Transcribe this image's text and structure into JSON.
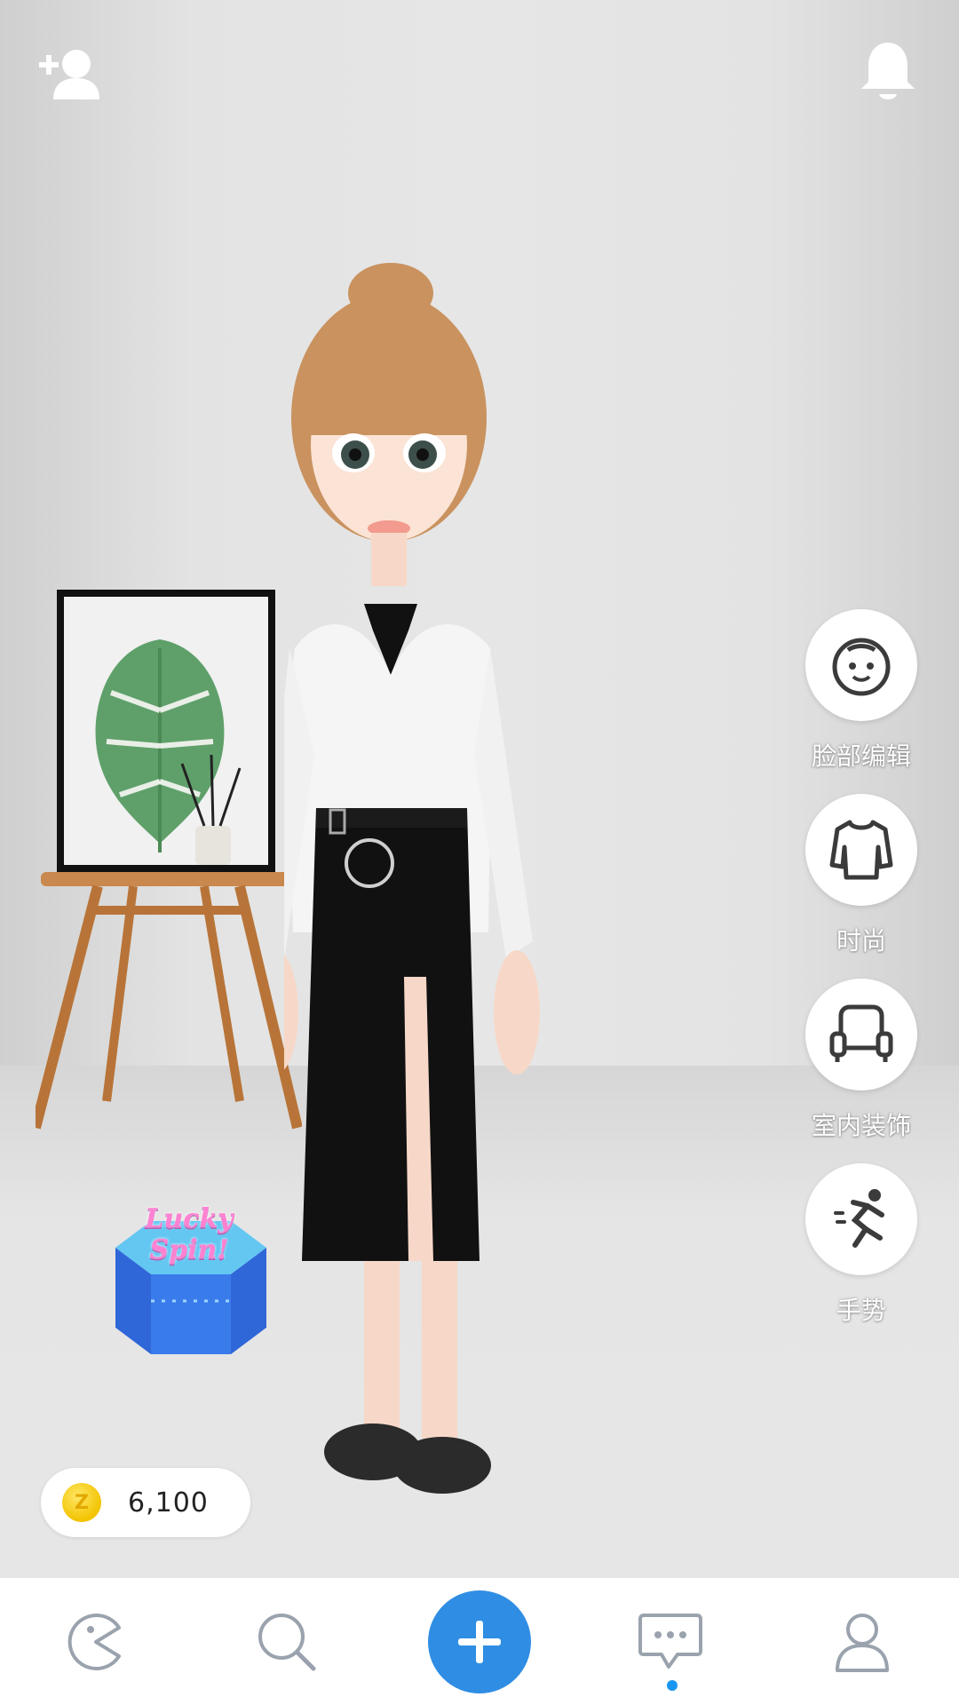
{
  "top_bar": {
    "add_friend_icon": "add-friend-icon",
    "notification_icon": "bell-icon"
  },
  "side_menu": {
    "items": [
      {
        "label": "脸部编辑",
        "icon": "face-icon"
      },
      {
        "label": "时尚",
        "icon": "shirt-icon"
      },
      {
        "label": "室内装饰",
        "icon": "sofa-icon"
      },
      {
        "label": "手势",
        "icon": "gesture-icon"
      }
    ]
  },
  "lucky_spin": {
    "text": "Lucky Spin!"
  },
  "wallet": {
    "coin_symbol": "Z",
    "coins": "6,100"
  },
  "bottom_nav": {
    "items": [
      {
        "icon": "home-pacman-icon"
      },
      {
        "icon": "search-icon"
      },
      {
        "icon": "plus-icon"
      },
      {
        "icon": "chat-icon"
      },
      {
        "icon": "profile-icon"
      }
    ]
  },
  "colors": {
    "accent": "#2f8de4",
    "dot": "#1a96f0",
    "icon_gray": "#9aa3ad",
    "coin": "#f2c300"
  }
}
